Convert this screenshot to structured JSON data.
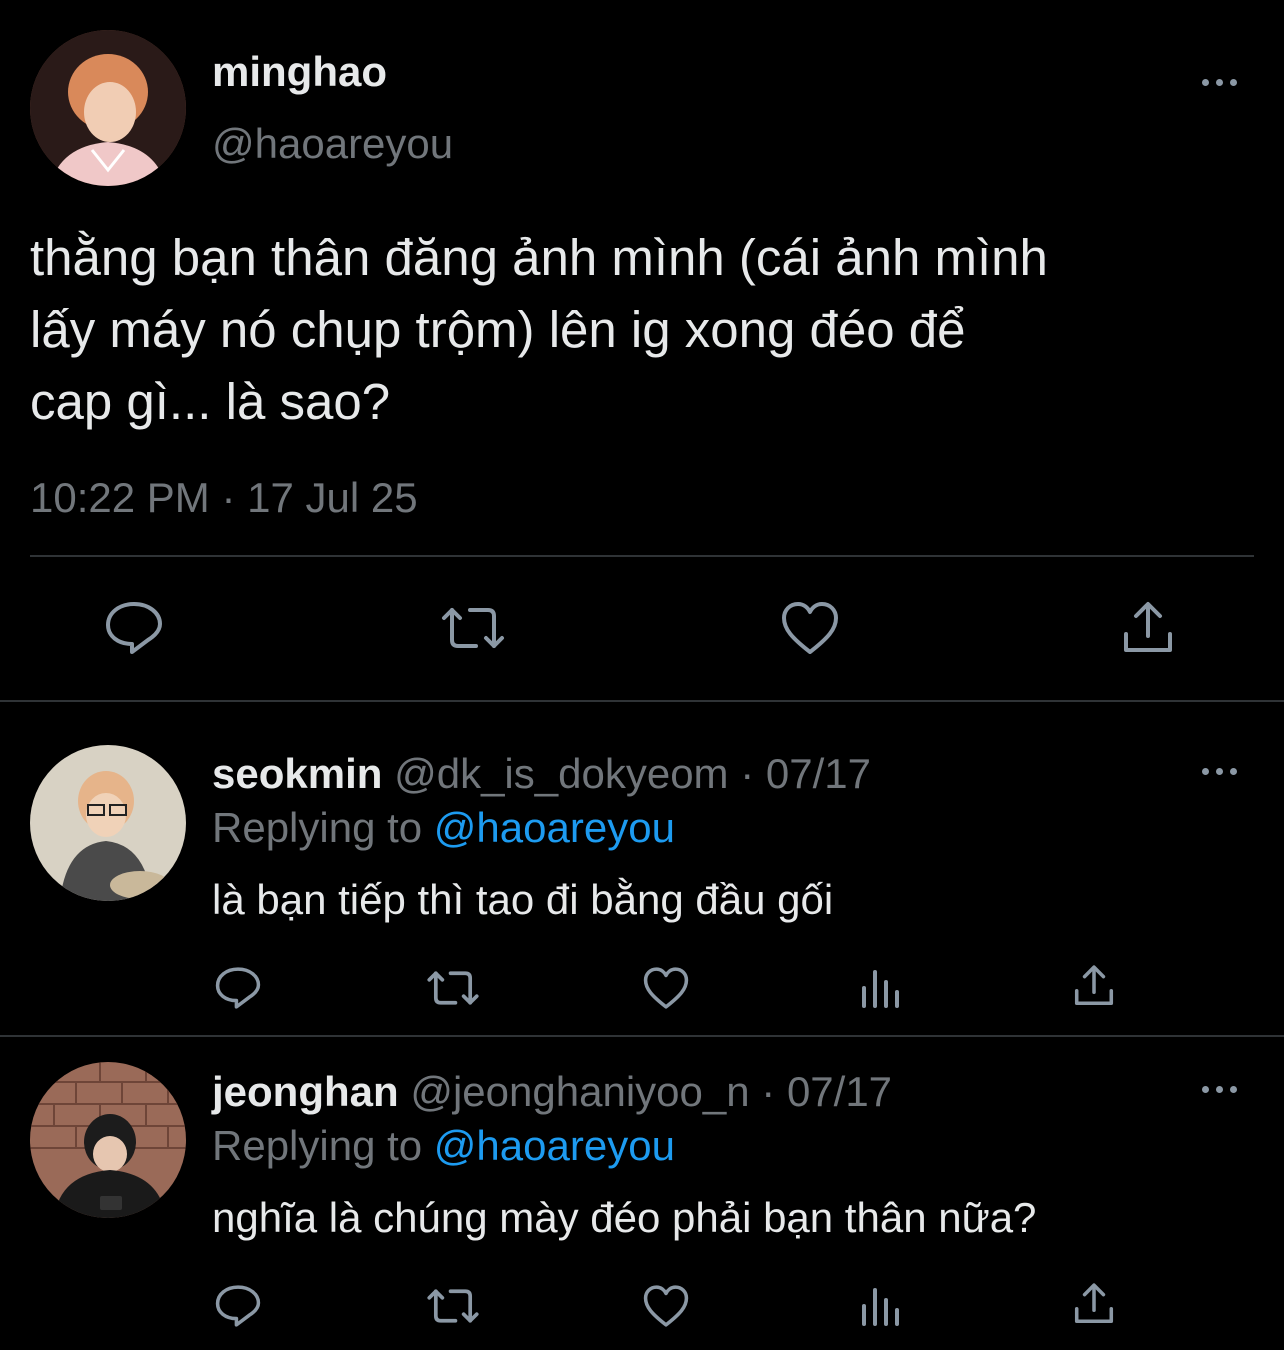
{
  "main_tweet": {
    "display_name": "minghao",
    "handle": "@haoareyou",
    "text_lines": [
      "thằng bạn thân đăng ảnh mình (cái ảnh mình",
      "lấy máy nó chụp trộm) lên ig xong đéo để",
      "cap gì... là sao?"
    ],
    "timestamp": "10:22 PM · 17 Jul 25",
    "actions": [
      "reply-icon",
      "retweet-icon",
      "like-icon",
      "share-icon"
    ]
  },
  "replies": [
    {
      "display_name": "seokmin",
      "handle": "@dk_is_dokyeom",
      "date": "07/17",
      "replying_prefix": "Replying to",
      "replying_handle": "@haoareyou",
      "text": "là bạn tiếp thì tao đi bằng đầu gối",
      "actions": [
        "reply-icon",
        "retweet-icon",
        "like-icon",
        "analytics-icon",
        "share-icon"
      ]
    },
    {
      "display_name": "jeonghan",
      "handle": "@jeonghaniyoo_n",
      "date": "07/17",
      "replying_prefix": "Replying to",
      "replying_handle": "@haoareyou",
      "text": "nghĩa là chúng mày đéo phải bạn thân nữa?",
      "actions": [
        "reply-icon",
        "retweet-icon",
        "like-icon",
        "analytics-icon",
        "share-icon"
      ]
    }
  ],
  "colors": {
    "background": "#000000",
    "text": "#e7e9ea",
    "muted": "#71767b",
    "link": "#1d9bf0",
    "divider": "#2f3336"
  }
}
